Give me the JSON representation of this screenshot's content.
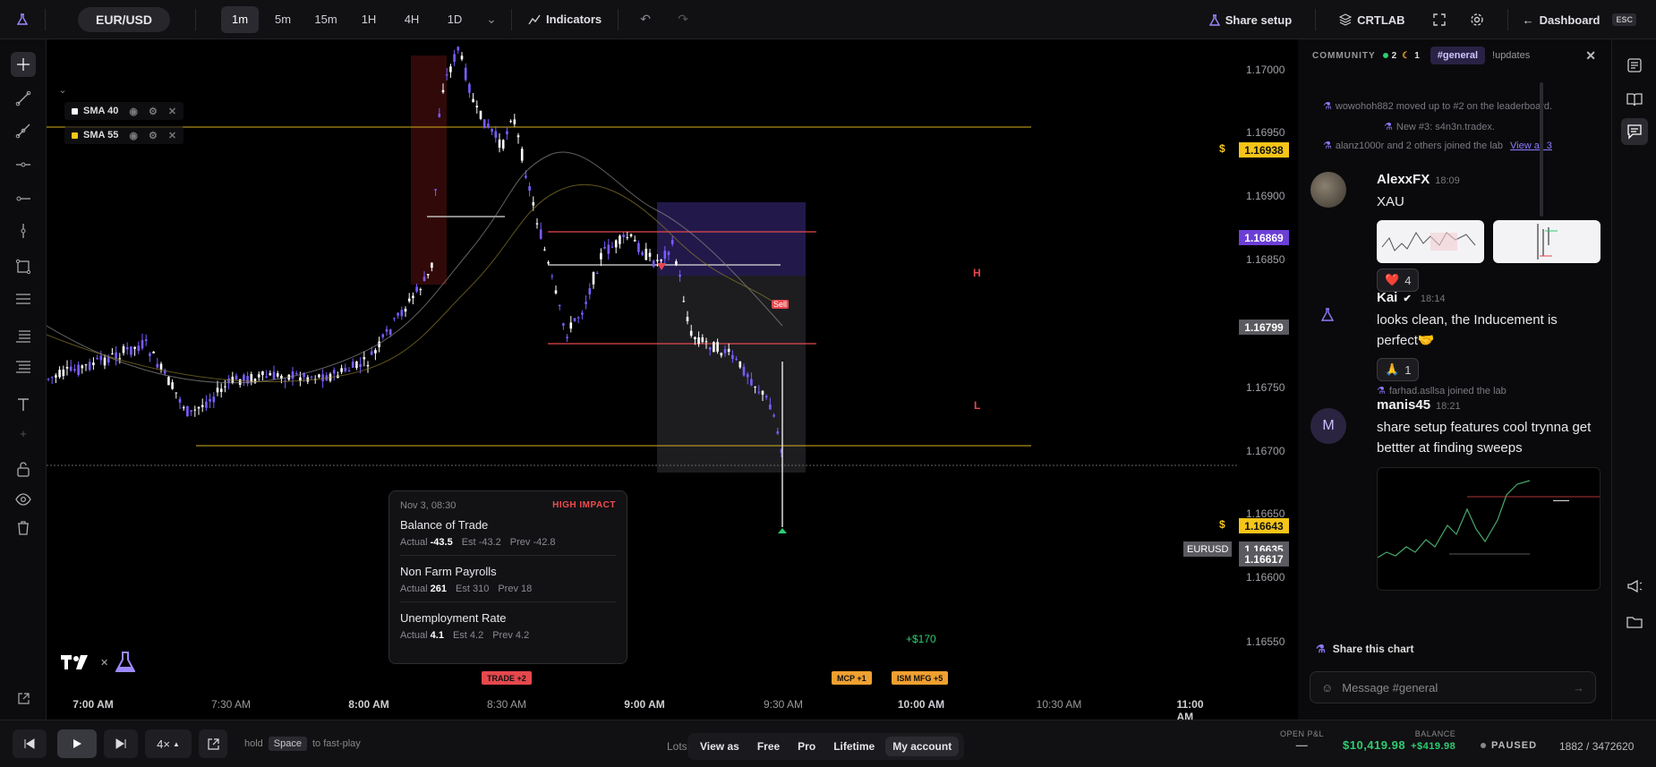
{
  "topbar": {
    "pair": "EUR/USD",
    "timeframes": [
      "1m",
      "5m",
      "15m",
      "1H",
      "4H",
      "1D"
    ],
    "active_timeframe": "1m",
    "indicators_label": "Indicators",
    "share_setup_label": "Share setup",
    "lab_label": "CRTLAB",
    "dashboard_label": "Dashboard",
    "esc_label": "ESC"
  },
  "indicators": [
    {
      "label": "SMA 40",
      "color": "#ffffff"
    },
    {
      "label": "SMA 55",
      "color": "#f5c518"
    }
  ],
  "price_axis": {
    "ticks": [
      "1.17000",
      "1.16950",
      "1.16900",
      "1.16850",
      "1.16750",
      "1.16700",
      "1.16650",
      "1.16600",
      "1.16550"
    ],
    "highlight_labels": [
      {
        "value": "1.16938",
        "type": "alert",
        "color": "#f5c518"
      },
      {
        "value": "1.16869",
        "type": "purple",
        "color": "#6b3fd6"
      },
      {
        "value": "1.16799",
        "type": "gray",
        "color": "#5a5a60"
      },
      {
        "value": "1.16643",
        "type": "alert",
        "color": "#f5c518"
      },
      {
        "value": "1.16635",
        "type": "gray",
        "color": "#5a5a60"
      },
      {
        "value": "1.16617",
        "type": "gray",
        "color": "#5a5a60"
      }
    ],
    "symbol_tag": "EURUSD",
    "alert_symbol": "$"
  },
  "time_axis": {
    "labels": [
      "7:00 AM",
      "7:30 AM",
      "8:00 AM",
      "8:30 AM",
      "9:00 AM",
      "9:30 AM",
      "10:00 AM",
      "10:30 AM",
      "11:00 AM"
    ]
  },
  "chart_annotations": {
    "high_label": "H",
    "low_label": "L",
    "sell_label": "Sell",
    "profit_label": "+$170"
  },
  "news_popup": {
    "datetime": "Nov 3, 08:30",
    "impact": "HIGH IMPACT",
    "items": [
      {
        "title": "Balance of Trade",
        "actual": "-43.5",
        "est": "-43.2",
        "prev": "-42.8"
      },
      {
        "title": "Non Farm Payrolls",
        "actual": "261",
        "est": "310",
        "prev": "18"
      },
      {
        "title": "Unemployment Rate",
        "actual": "4.1",
        "est": "4.2",
        "prev": "4.2"
      }
    ],
    "actual_label": "Actual",
    "est_label": "Est",
    "prev_label": "Prev"
  },
  "event_tags": [
    {
      "label": "TRADE +2",
      "color": "#e5484d"
    },
    {
      "label": "MCP +1",
      "color": "#f0a030"
    },
    {
      "label": "ISM MFG +5",
      "color": "#f0a030"
    }
  ],
  "bottombar": {
    "speed": "4×",
    "hint_hold": "hold",
    "hint_key": "Space",
    "hint_action": "to fast-play",
    "lots_label": "Lots",
    "plans": [
      "View as",
      "Free",
      "Pro",
      "Lifetime",
      "My account"
    ],
    "selected_plan": "My account",
    "open_pnl_label": "OPEN P&L",
    "open_pnl_value": "—",
    "balance_label": "BALANCE",
    "balance_value": "$10,419.98",
    "balance_change": "+$419.98",
    "status": "PAUSED",
    "progress": "1882 / 3472620"
  },
  "community": {
    "title": "COMMUNITY",
    "online_count": "2",
    "away_count": "1",
    "channel_active": "#general",
    "channel_other": "!updates",
    "system_messages": [
      "wowohoh882 moved up to #2 on the leaderboard.",
      "New #3: s4n3n.tradex.",
      "alanz1000r and 2 others joined the lab",
      "farhad.asllsa joined the lab"
    ],
    "view_all": "View all 3",
    "messages": [
      {
        "author": "AlexxFX",
        "time": "18:09",
        "text": "XAU",
        "reaction": "4",
        "reaction_icon": "❤️"
      },
      {
        "author": "Kai",
        "time": "18:14",
        "text_line1": "looks clean, the Inducement is",
        "text_line2": "perfect🤝",
        "reaction": "1",
        "reaction_icon": "🙏"
      },
      {
        "author": "manis45",
        "time": "18:21",
        "avatar_letter": "M",
        "text_line1": "share setup features cool trynna get",
        "text_line2": "bettter at finding sweeps"
      }
    ],
    "share_chart_label": "Share this chart",
    "input_placeholder": "Message #general"
  }
}
